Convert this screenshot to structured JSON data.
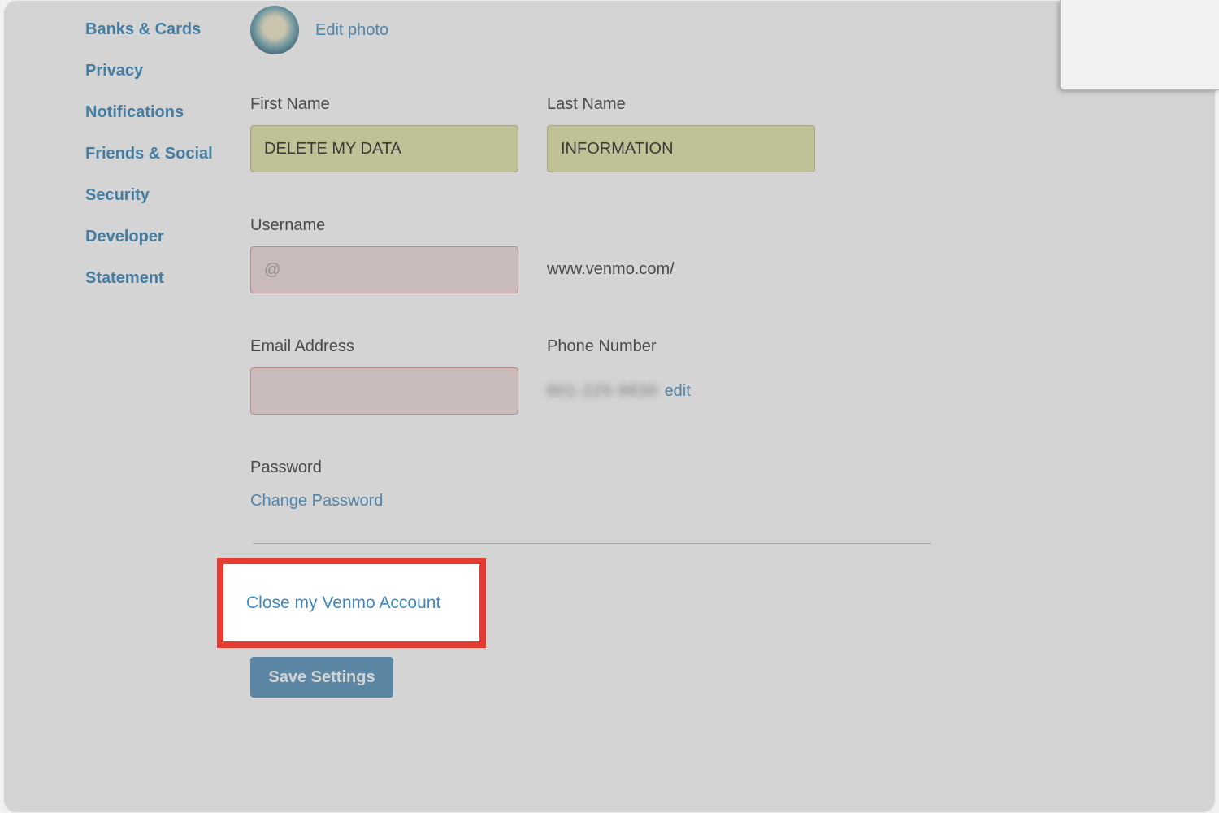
{
  "sidebar": {
    "items": [
      {
        "label": "Banks & Cards"
      },
      {
        "label": "Privacy"
      },
      {
        "label": "Notifications"
      },
      {
        "label": "Friends & Social"
      },
      {
        "label": "Security"
      },
      {
        "label": "Developer"
      },
      {
        "label": "Statement"
      }
    ]
  },
  "profile": {
    "edit_photo": "Edit photo"
  },
  "form": {
    "first_name_label": "First Name",
    "first_name_value": "DELETE MY DATA",
    "last_name_label": "Last Name",
    "last_name_value": "INFORMATION",
    "username_label": "Username",
    "username_placeholder": "@",
    "username_hint": "www.venmo.com/",
    "email_label": "Email Address",
    "email_value": "",
    "phone_label": "Phone Number",
    "phone_edit": "edit",
    "password_label": "Password",
    "change_password": "Change Password"
  },
  "actions": {
    "close_account": "Close my Venmo Account",
    "save": "Save Settings"
  }
}
